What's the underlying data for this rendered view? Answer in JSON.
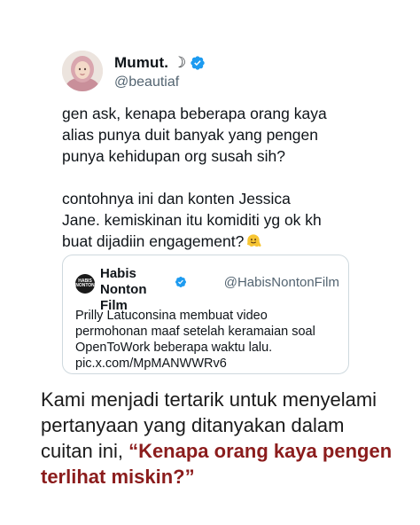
{
  "tweet": {
    "display_name": "Mumut. ☽",
    "handle": "@beautiaf",
    "verified_icon": "verified-badge-icon",
    "avatar_icon": "avatar-photo",
    "paragraph_1": "gen ask, kenapa beberapa orang kaya\nalias punya duit banyak yang pengen\npunya kehidupan org susah sih?",
    "paragraph_2": "contohnya ini dan konten Jessica\nJane. kemiskinan itu komiditi yg ok kh\nbuat dijadiin engagement?",
    "emoji_icon": "melting-face-icon"
  },
  "quoted_tweet": {
    "display_name": "Habis Nonton\nFilm",
    "handle": "@HabisNontonFilm",
    "avatar_text": "HABIS NONTON",
    "text": "Prilly Latuconsina membuat video\npermohonan maaf setelah keramaian soal\nOpenToWork beberapa waktu lalu.\npic.x.com/MpMANWWRv6"
  },
  "caption": {
    "text": "Kami menjadi tertarik untuk menyelami pertanyaan yang ditanyakan dalam cuitan ini, ",
    "highlight": "“Kenapa orang kaya pengen terlihat miskin?”"
  },
  "colors": {
    "accent_blue": "#1d9bf0",
    "highlight_red": "#8b1c1c",
    "text": "#0f1419",
    "muted": "#536471"
  }
}
